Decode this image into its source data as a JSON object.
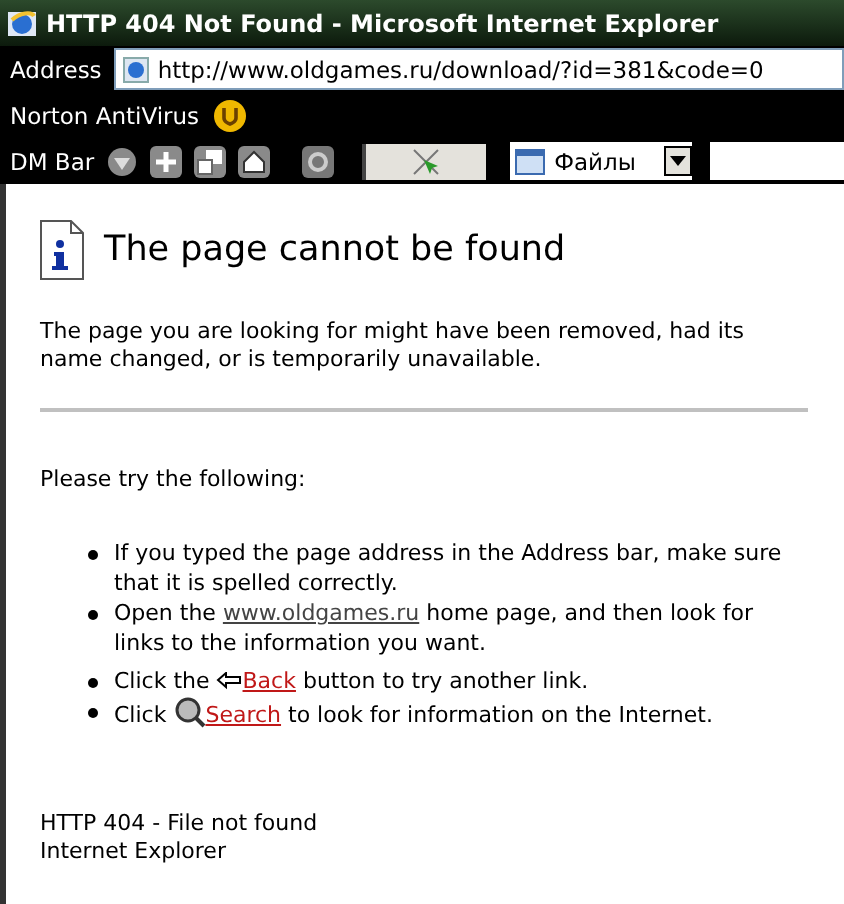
{
  "window": {
    "title": "HTTP 404 Not Found - Microsoft Internet Explorer"
  },
  "address_bar": {
    "label": "Address",
    "value": "http://www.oldgames.ru/download/?id=381&code=0"
  },
  "norton_bar": {
    "label": "Norton AntiVirus"
  },
  "dm_bar": {
    "label": "DM Bar",
    "dropdown": {
      "value": "Файлы",
      "expanded": false
    }
  },
  "page": {
    "heading": "The page cannot be found",
    "intro": "The page you are looking for might have been removed, had its name changed, or is temporarily unavailable.",
    "try_heading": "Please try the following:",
    "bullets": [
      {
        "parts": [
          {
            "kind": "text",
            "text": "If you typed the page address in the Address bar, make sure that it is spelled correctly."
          }
        ]
      },
      {
        "parts": [
          {
            "kind": "text",
            "text": "Open the "
          },
          {
            "kind": "link",
            "text": "www.oldgames.ru"
          },
          {
            "kind": "text",
            "text": " home page, and then look for links to the information you want."
          }
        ]
      },
      {
        "parts": [
          {
            "kind": "text",
            "text": "Click the "
          },
          {
            "kind": "back",
            "text": "Back"
          },
          {
            "kind": "text",
            "text": " button to try another link."
          }
        ]
      },
      {
        "parts": [
          {
            "kind": "text",
            "text": "Click "
          },
          {
            "kind": "search",
            "text": "Search"
          },
          {
            "kind": "text",
            "text": " to look for information on the Internet."
          }
        ]
      }
    ],
    "footer": [
      "HTTP 404 - File not found",
      "Internet Explorer"
    ]
  }
}
